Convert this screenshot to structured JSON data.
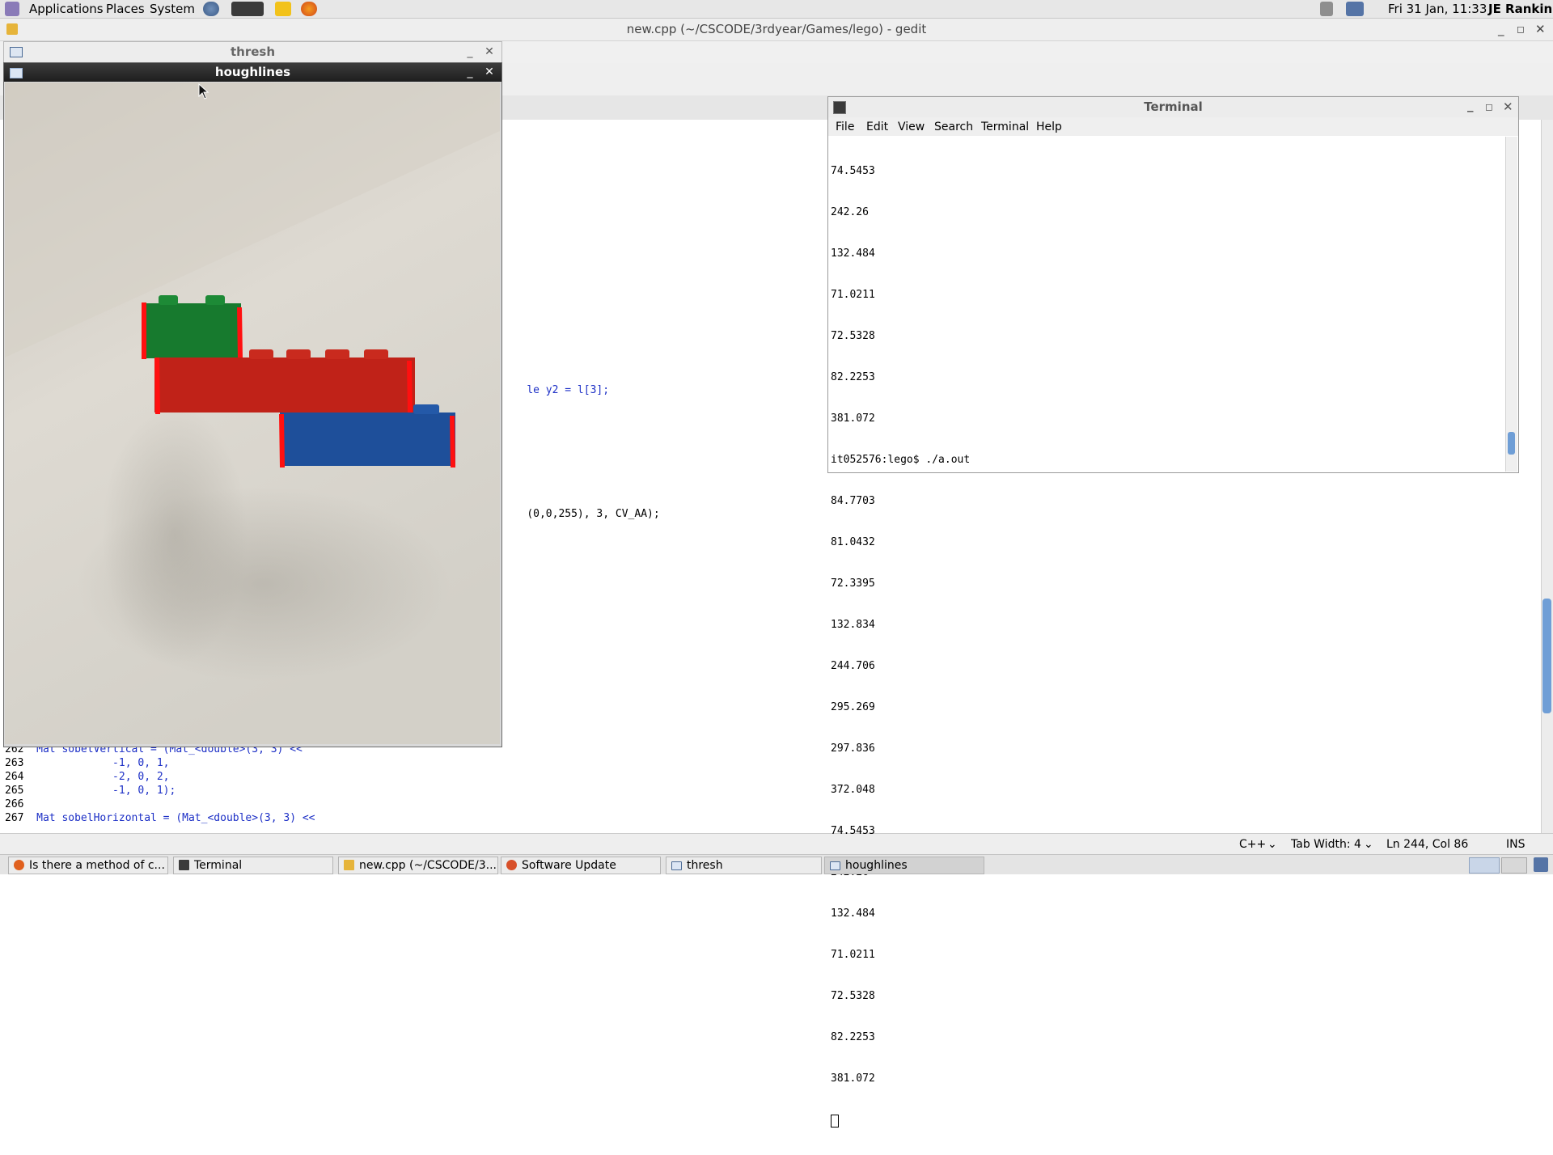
{
  "top_panel": {
    "menus": [
      "Applications",
      "Places",
      "System"
    ],
    "clock": "Fri 31 Jan, 11:33",
    "user": "JE Rankin"
  },
  "gedit": {
    "title": "new.cpp (~/CSCODE/3rdyear/Games/lego) - gedit",
    "code_fragment_1": "le y2 = l[3];",
    "code_fragment_2": "(0,0,255), 3, CV_AA);",
    "lines": [
      {
        "num": "262",
        "text": "Mat sobelVertical = (Mat_<double>(3, 3) <<"
      },
      {
        "num": "263",
        "text": "            -1, 0, 1,"
      },
      {
        "num": "264",
        "text": "            -2, 0, 2,"
      },
      {
        "num": "265",
        "text": "            -1, 0, 1);"
      },
      {
        "num": "266",
        "text": ""
      },
      {
        "num": "267",
        "text": "Mat sobelHorizontal = (Mat_<double>(3, 3) <<"
      }
    ],
    "status": {
      "language": "C++",
      "tab_width": "Tab Width: 4",
      "position": "Ln 244, Col 86",
      "mode": "INS"
    }
  },
  "windows": {
    "thresh_title": "thresh",
    "houghlines_title": "houghlines"
  },
  "terminal": {
    "title": "Terminal",
    "menu": [
      "File",
      "Edit",
      "View",
      "Search",
      "Terminal",
      "Help"
    ],
    "output": [
      "74.5453",
      "242.26",
      "132.484",
      "71.0211",
      "72.5328",
      "82.2253",
      "381.072",
      "it052576:lego$ ./a.out",
      "84.7703",
      "81.0432",
      "72.3395",
      "132.834",
      "244.706",
      "295.269",
      "297.836",
      "372.048",
      "74.5453",
      "242.26",
      "132.484",
      "71.0211",
      "72.5328",
      "82.2253",
      "381.072"
    ]
  },
  "taskbar": {
    "items": [
      "Is there a method of c...",
      "Terminal",
      "new.cpp (~/CSCODE/3...",
      "Software Update",
      "thresh",
      "houghlines"
    ]
  }
}
